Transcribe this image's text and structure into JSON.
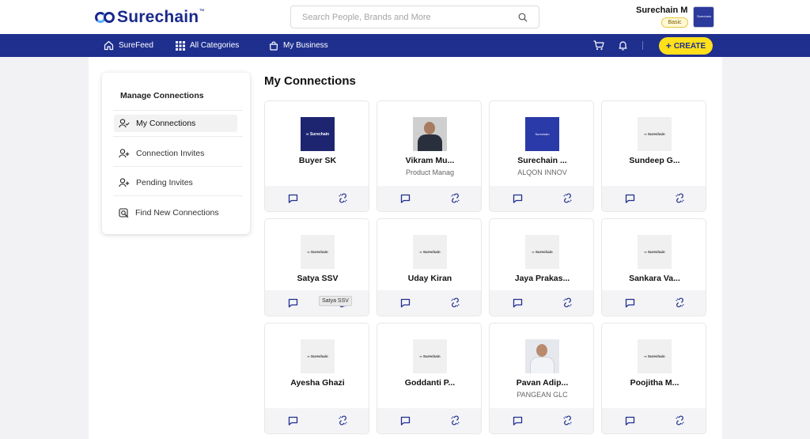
{
  "header": {
    "logo_text": "Surechain",
    "logo_tm": "™",
    "search_placeholder": "Search People, Brands and More",
    "user_name": "Surechain M",
    "plan_badge": "Basic",
    "avatar_text": "Surechain"
  },
  "nav": {
    "surefeed": "SureFeed",
    "all_categories": "All Categories",
    "my_business": "My Business",
    "create_label": "CREATE"
  },
  "sidebar": {
    "title": "Manage Connections",
    "items": [
      {
        "label": "My Connections",
        "active": true
      },
      {
        "label": "Connection Invites",
        "active": false
      },
      {
        "label": "Pending Invites",
        "active": false
      },
      {
        "label": "Find New Connections",
        "active": false
      }
    ]
  },
  "page_title": "My Connections",
  "connections": [
    {
      "name": "Buyer SK",
      "subtitle": "",
      "thumb": "dark-logo"
    },
    {
      "name": "Vikram Mu...",
      "subtitle": "Product Manag",
      "thumb": "photo"
    },
    {
      "name": "Surechain ...",
      "subtitle": "ALQON INNOV",
      "thumb": "blue-logo"
    },
    {
      "name": "Sundeep G...",
      "subtitle": "",
      "thumb": "logo"
    },
    {
      "name": "Satya SSV",
      "subtitle": "",
      "thumb": "logo"
    },
    {
      "name": "Uday Kiran",
      "subtitle": "",
      "thumb": "logo"
    },
    {
      "name": "Jaya Prakas...",
      "subtitle": "",
      "thumb": "logo"
    },
    {
      "name": "Sankara Va...",
      "subtitle": "",
      "thumb": "logo"
    },
    {
      "name": "Ayesha Ghazi",
      "subtitle": "",
      "thumb": "logo"
    },
    {
      "name": "Goddanti P...",
      "subtitle": "",
      "thumb": "logo"
    },
    {
      "name": "Pavan Adip...",
      "subtitle": "PANGEAN GLC",
      "thumb": "photo-light"
    },
    {
      "name": "Poojitha M...",
      "subtitle": "",
      "thumb": "logo"
    }
  ],
  "thumb_text": {
    "mini_logo": "∞ Surechain",
    "dark_logo": "∞ Surechain",
    "blue_logo": "Surechain"
  },
  "tooltip": "Satya SSV",
  "colors": {
    "brand": "#1e2f8e",
    "accent": "#ffe01b",
    "icon": "#1e2f8e"
  }
}
